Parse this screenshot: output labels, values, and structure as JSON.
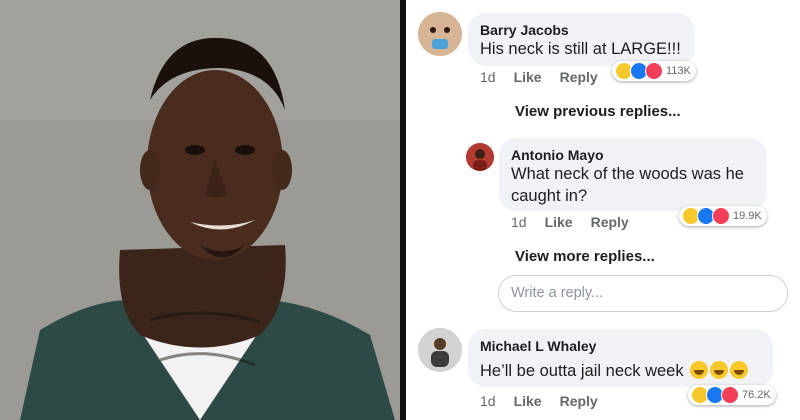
{
  "comments": [
    {
      "author": "Barry Jacobs",
      "text": "His neck is still at LARGE!!!",
      "age": "1d",
      "like": "Like",
      "reply": "Reply",
      "reactions": "113K"
    },
    {
      "author": "Antonio Mayo",
      "text": "What neck of the woods was he caught in?",
      "age": "1d",
      "like": "Like",
      "reply": "Reply",
      "reactions": "19.9K"
    },
    {
      "author": "Michael L Whaley",
      "text": "He’ll be outta jail neck week",
      "emoji_suffix": [
        "laughing-tears",
        "laughing-tears",
        "laughing-tears"
      ],
      "age": "1d",
      "like": "Like",
      "reply": "Reply",
      "reactions": "76.2K"
    }
  ],
  "view_previous": "View previous replies...",
  "view_more": "View more replies...",
  "reply_placeholder": "Write a reply...",
  "colors": {
    "bubble": "#f0f2f5",
    "like": "#1877f2",
    "love": "#f33e58",
    "haha": "#f7c829"
  },
  "icons": {
    "reaction_set": [
      "haha-icon",
      "like-icon",
      "love-icon"
    ]
  }
}
